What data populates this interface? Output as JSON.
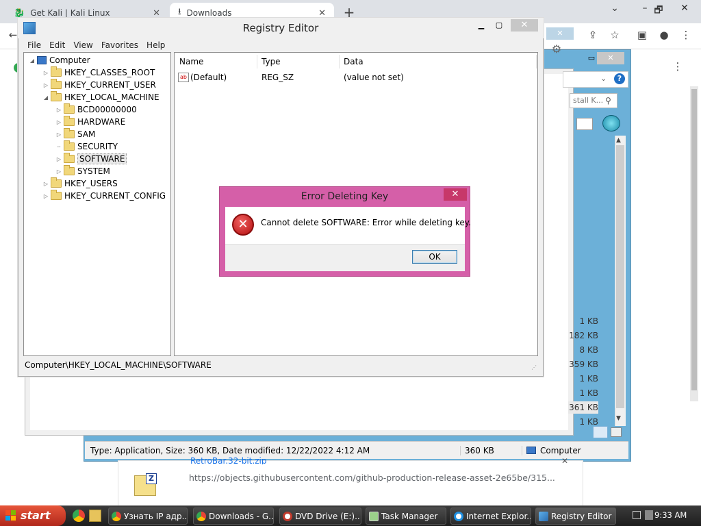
{
  "browser": {
    "tabs": [
      {
        "label": "Get Kali | Kali Linux"
      },
      {
        "label": "Downloads"
      }
    ],
    "new_tab": "+",
    "window_controls": {
      "minimize": "⌄",
      "restore": "🗗",
      "close": "✕"
    },
    "download_shelf": {
      "file_name": "RetroBar.32-bit.zip",
      "url": "https://objects.githubusercontent.com/github-production-release-asset-2e65be/315..."
    }
  },
  "explorer": {
    "search_placeholder": "stall K...",
    "sizes": [
      "1 KB",
      "182 KB",
      "8 KB",
      "359 KB",
      "1 KB",
      "1 KB",
      "361 KB",
      "1 KB"
    ],
    "status": {
      "info": "Type: Application, Size: 360 KB, Date modified: 12/22/2022 4:12 AM",
      "size": "360 KB",
      "location": "Computer"
    }
  },
  "regedit": {
    "title": "Registry Editor",
    "menu": [
      "File",
      "Edit",
      "View",
      "Favorites",
      "Help"
    ],
    "tree": {
      "root": "Computer",
      "hives": [
        "HKEY_CLASSES_ROOT",
        "HKEY_CURRENT_USER",
        "HKEY_LOCAL_MACHINE",
        "HKEY_USERS",
        "HKEY_CURRENT_CONFIG"
      ],
      "hklm_children": [
        "BCD00000000",
        "HARDWARE",
        "SAM",
        "SECURITY",
        "SOFTWARE",
        "SYSTEM"
      ]
    },
    "columns": [
      "Name",
      "Type",
      "Data"
    ],
    "values": [
      {
        "name": "(Default)",
        "type": "REG_SZ",
        "data": "(value not set)"
      }
    ],
    "status_path": "Computer\\HKEY_LOCAL_MACHINE\\SOFTWARE"
  },
  "dialog": {
    "title": "Error Deleting Key",
    "message": "Cannot delete SOFTWARE:  Error while deleting key.",
    "ok_label": "OK",
    "close": "✕",
    "icon": "error-icon",
    "accent_color": "#d55fa8"
  },
  "taskbar": {
    "start_label": "start",
    "buttons": [
      {
        "label": "Узнать IP адр..."
      },
      {
        "label": "Downloads - G..."
      },
      {
        "label": "DVD Drive (E:)..."
      },
      {
        "label": "Task Manager"
      },
      {
        "label": "Internet Explor..."
      },
      {
        "label": "Registry Editor"
      }
    ],
    "clock": "9:33 AM"
  }
}
